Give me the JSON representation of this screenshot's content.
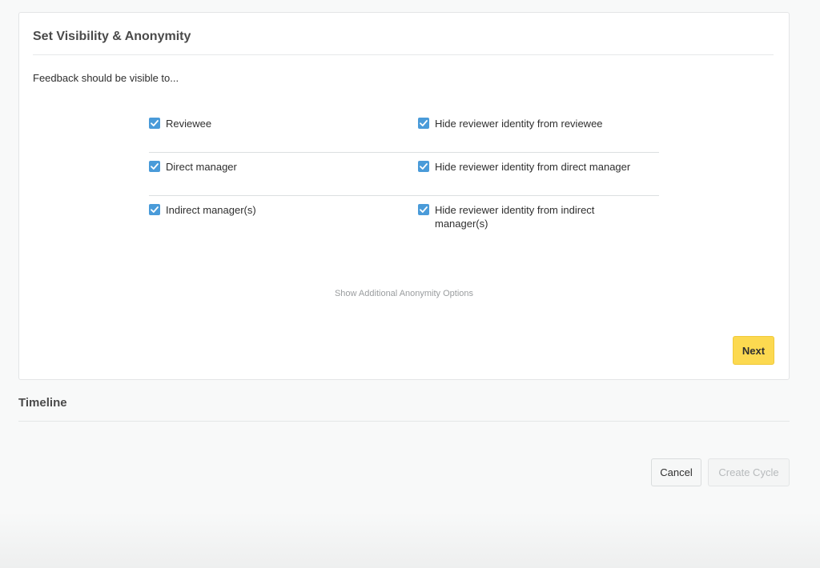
{
  "visibility_card": {
    "title": "Set Visibility & Anonymity",
    "intro": "Feedback should be visible to...",
    "rows": [
      {
        "visible_label": "Reviewee",
        "visible_checked": true,
        "hide_label": "Hide reviewer identity from reviewee",
        "hide_checked": true
      },
      {
        "visible_label": "Direct manager",
        "visible_checked": true,
        "hide_label": "Hide reviewer identity from direct manager",
        "hide_checked": true
      },
      {
        "visible_label": "Indirect manager(s)",
        "visible_checked": true,
        "hide_label": "Hide reviewer identity from indirect manager(s)",
        "hide_checked": true
      }
    ],
    "more_options_link": "Show Additional Anonymity Options",
    "next_label": "Next"
  },
  "timeline_section": {
    "title": "Timeline"
  },
  "footer": {
    "cancel_label": "Cancel",
    "create_label": "Create Cycle",
    "create_disabled": true
  },
  "colors": {
    "accent_checkbox": "#4a9bd9",
    "primary_button": "#fcd950"
  },
  "icons": {
    "checkbox": "checkmark-icon"
  }
}
